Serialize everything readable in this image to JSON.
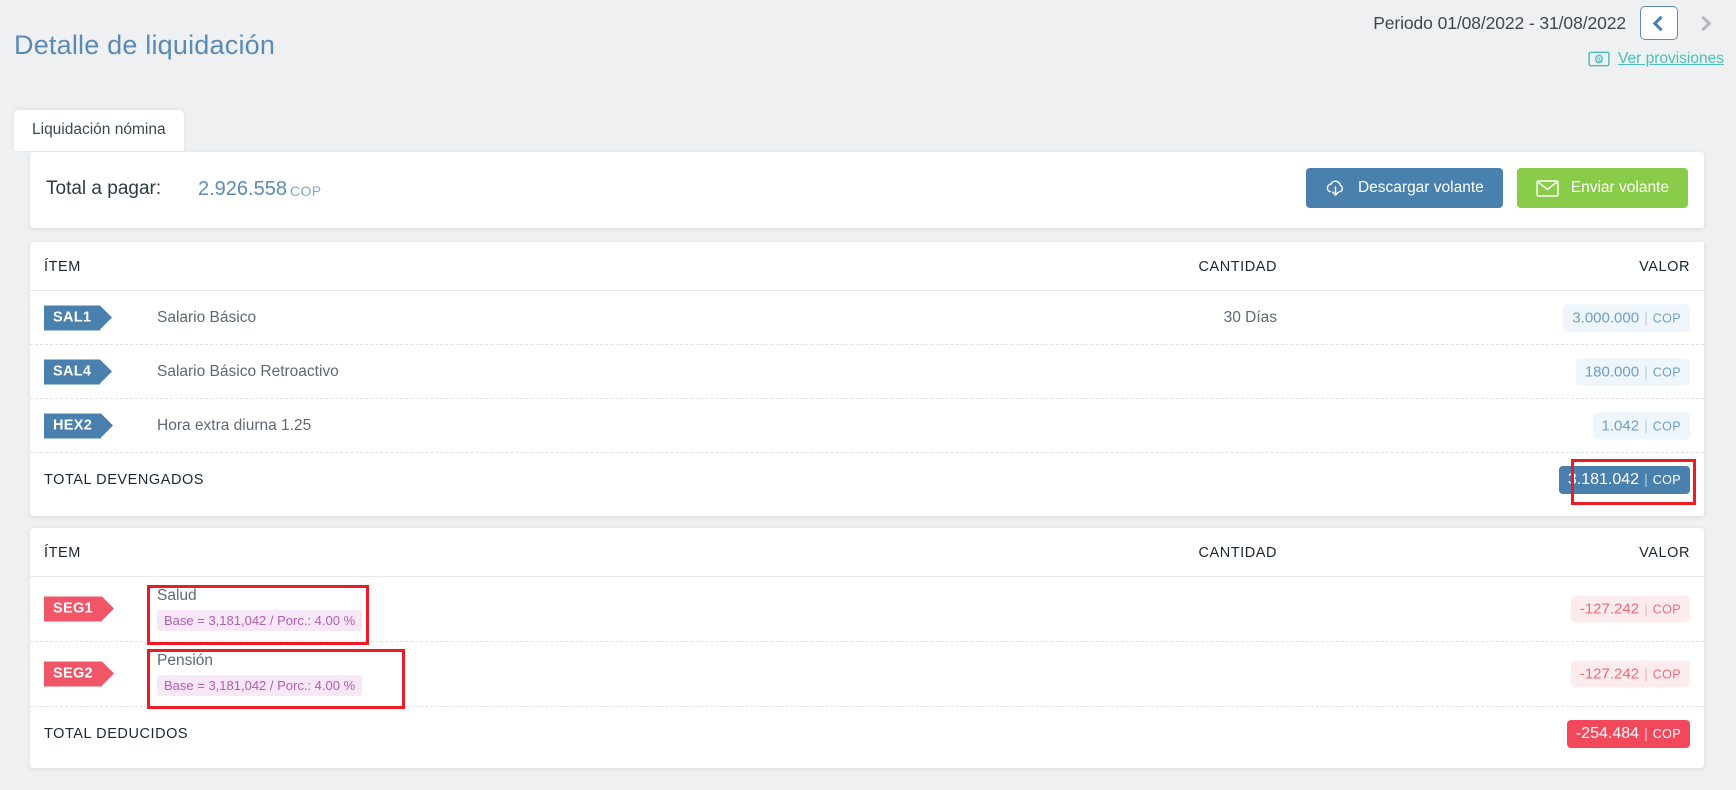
{
  "header": {
    "title": "Detalle de liquidación",
    "period_label": "Periodo 01/08/2022 - 31/08/2022",
    "prev_icon": "chevron-left-icon",
    "next_icon": "chevron-right-icon",
    "provisions_link": "Ver provisiones",
    "provisions_icon": "money-bill-icon",
    "accent_blue": "#5b8bb5",
    "accent_teal": "#4cc0b5"
  },
  "tabs": [
    {
      "label": "Liquidación nómina",
      "active": true
    }
  ],
  "summary": {
    "total_label": "Total a pagar:",
    "total_value": "2.926.558",
    "currency": "COP",
    "download_button": "Descargar volante",
    "download_icon": "cloud-download-icon",
    "send_button": "Enviar volante",
    "send_icon": "envelope-icon"
  },
  "earnings": {
    "columns": {
      "item": "ÍTEM",
      "quantity": "CANTIDAD",
      "value": "VALOR"
    },
    "rows": [
      {
        "code": "SAL1",
        "name": "Salario Básico",
        "quantity": "30  Días",
        "value": "3.000.000",
        "currency": "COP"
      },
      {
        "code": "SAL4",
        "name": "Salario Básico Retroactivo",
        "quantity": "",
        "value": "180.000",
        "currency": "COP"
      },
      {
        "code": "HEX2",
        "name": "Hora extra diurna 1.25",
        "quantity": "",
        "value": "1.042",
        "currency": "COP"
      }
    ],
    "total_label": "TOTAL DEVENGADOS",
    "total_value": "3.181.042",
    "total_currency": "COP"
  },
  "deductions": {
    "columns": {
      "item": "ÍTEM",
      "quantity": "CANTIDAD",
      "value": "VALOR"
    },
    "rows": [
      {
        "code": "SEG1",
        "name": "Salud",
        "detail": "Base = 3,181,042 / Porc.: 4.00 %",
        "quantity": "",
        "value": "-127.242",
        "currency": "COP"
      },
      {
        "code": "SEG2",
        "name": "Pensión",
        "detail": "Base = 3,181,042 / Porc.: 4.00 %",
        "quantity": "",
        "value": "-127.242",
        "currency": "COP"
      }
    ],
    "total_label": "TOTAL DEDUCIDOS",
    "total_value": "-254.484",
    "total_currency": "COP"
  },
  "annotations": {
    "color": "#ee1b24",
    "boxes": [
      "total-devengados-value",
      "salud-detail",
      "pension-detail"
    ]
  }
}
